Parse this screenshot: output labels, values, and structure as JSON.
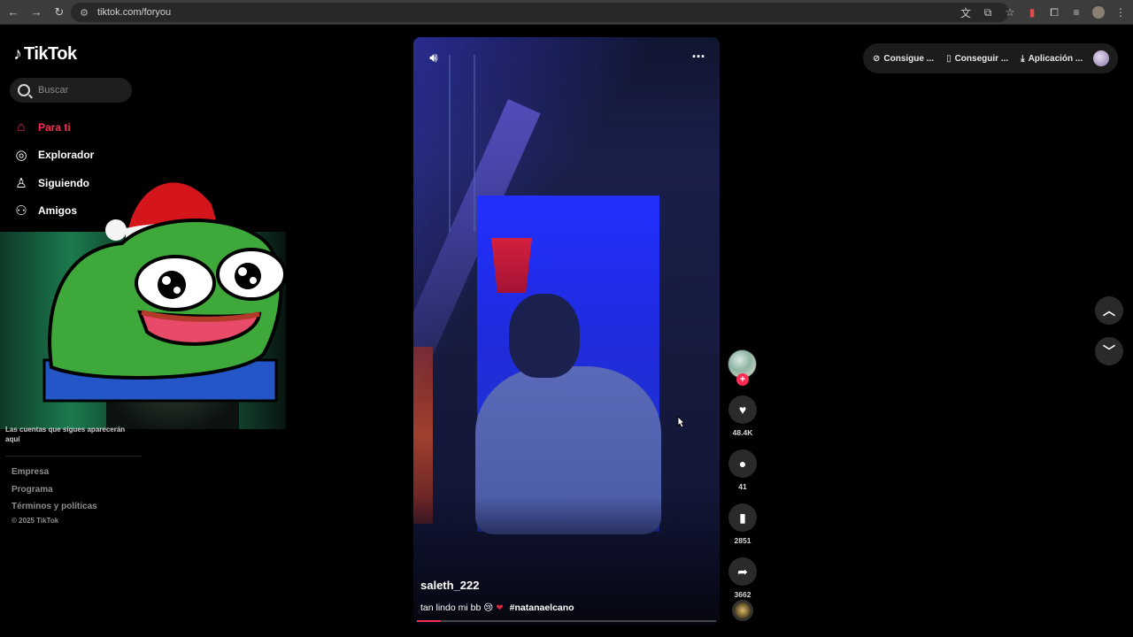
{
  "browser": {
    "url": "tiktok.com/foryou"
  },
  "sidebar": {
    "logo_text": "TikTok",
    "search_placeholder": "Buscar",
    "items": [
      {
        "label": "Para ti",
        "icon": "home-icon",
        "active": true
      },
      {
        "label": "Explorador",
        "icon": "compass-icon",
        "active": false
      },
      {
        "label": "Siguiendo",
        "icon": "following-icon",
        "active": false
      },
      {
        "label": "Amigos",
        "icon": "friends-icon",
        "active": false
      }
    ],
    "note": "Las cuentas que sigues aparecerán aquí",
    "footer_links": [
      "Empresa",
      "Programa",
      "Términos y políticas"
    ],
    "copyright": "© 2025 TikTok"
  },
  "video": {
    "author": "saleth_222",
    "caption": "tan lindo mi bb",
    "hashtag": "#natanaelcano",
    "progress": 0.08
  },
  "actions": {
    "likes": "48.4K",
    "comments": "41",
    "saves": "2851",
    "shares": "3662"
  },
  "top_bar": {
    "items": [
      {
        "label": "Consigue ...",
        "icon": "coin-icon"
      },
      {
        "label": "Conseguir ...",
        "icon": "phone-icon"
      },
      {
        "label": "Aplicación ...",
        "icon": "download-icon"
      }
    ]
  },
  "colors": {
    "accent": "#fe2c55",
    "background": "#000000"
  }
}
